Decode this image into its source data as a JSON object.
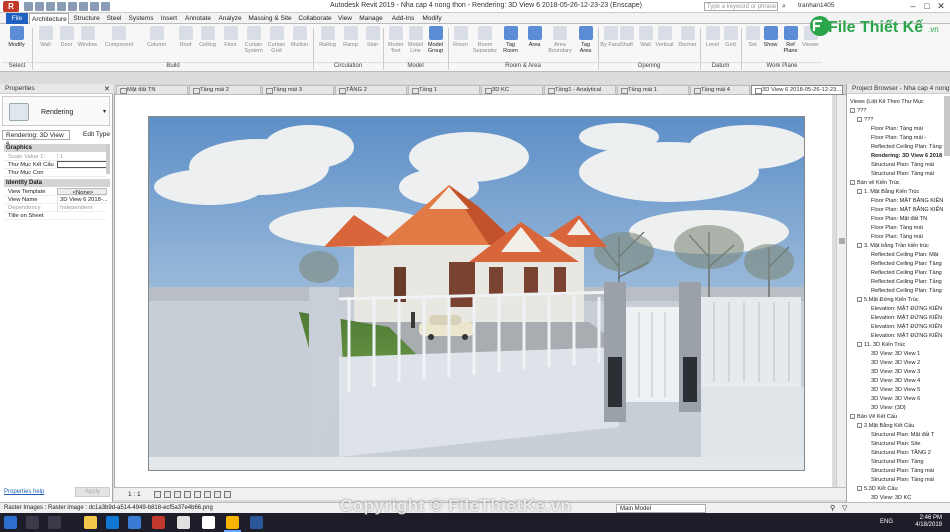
{
  "titlebar": {
    "window_title": "Autodesk Revit 2019 - Nha cap 4 nong thon - Rendering: 3D View 6 2018-05-26-12-23-23 (Enscape)",
    "search_placeholder": "Type a keyword or phrase",
    "user": "tranhan1405"
  },
  "ribbon": {
    "tabs": [
      "File",
      "Architecture",
      "Structure",
      "Steel",
      "Systems",
      "Insert",
      "Annotate",
      "Analyze",
      "Massing & Site",
      "Collaborate",
      "View",
      "Manage",
      "Add-Ins",
      "Modify"
    ],
    "active_tab": "Architecture",
    "tools": [
      "Modify",
      "Wall",
      "Door",
      "Window",
      "Component",
      "Column",
      "Roof",
      "Ceiling",
      "Floor",
      "Curtain System",
      "Curtain Grid",
      "Mullion",
      "Railing",
      "Ramp",
      "Stair",
      "Model Text",
      "Model Line",
      "Model Group",
      "Room",
      "Room Separator",
      "Tag Room",
      "Area",
      "Area Boundary",
      "Tag Area",
      "By Face",
      "Shaft",
      "Wall",
      "Vertical",
      "Dormer",
      "Level",
      "Grid",
      "Set",
      "Show",
      "Ref Plane",
      "Viewer"
    ],
    "groups": [
      "Select",
      "Build",
      "Circulation",
      "Model",
      "Room & Area",
      "Opening",
      "Datum",
      "Work Plane"
    ]
  },
  "properties": {
    "title": "Properties",
    "type_name": "Rendering",
    "selector": "Rendering: 3D View 6",
    "edit_type": "Edit Type",
    "sections": {
      "graphics": "Graphics",
      "identity": "Identity Data"
    },
    "rows": [
      {
        "k": "Scale Value 1:",
        "v": "1"
      },
      {
        "k": "Thư Mục Kết Cấu",
        "v": ""
      },
      {
        "k": "Thư Mục Con",
        "v": ""
      },
      {
        "k": "View Template",
        "v": "<None>"
      },
      {
        "k": "View Name",
        "v": "3D View 6 2018-..."
      },
      {
        "k": "Dependency",
        "v": "Independent"
      },
      {
        "k": "Title on Sheet",
        "v": ""
      }
    ],
    "help": "Properties help",
    "apply": "Apply"
  },
  "view_tabs": [
    "Mặt đất TN",
    "Tầng mái 2",
    "Tầng mái 3",
    "TẦNG 2",
    "Tầng 1",
    "3D KC",
    "Tầng1 - Analytical",
    "Tầng mái 1",
    "Tầng mái 4",
    "3D View 6 2018-05-26-12-23..."
  ],
  "view_tab_active": 9,
  "view_bar": {
    "scale": "1 : 1"
  },
  "project_browser": {
    "title": "Project Browser - Nha cap 4 nong...",
    "items": [
      {
        "t": "Views (Liệt Kê Theo Thư Mục",
        "i": 0,
        "tg": ""
      },
      {
        "t": "???",
        "i": 0,
        "tg": "-"
      },
      {
        "t": "???",
        "i": 1,
        "tg": "-"
      },
      {
        "t": "Floor Plan: Tầng mái",
        "i": 3,
        "tg": ""
      },
      {
        "t": "Floor Plan: Tầng mái -",
        "i": 3,
        "tg": ""
      },
      {
        "t": "Reflected Ceiling Plan: Tầng",
        "i": 3,
        "tg": ""
      },
      {
        "t": "Rendering: 3D View 6 2018",
        "i": 3,
        "tg": "",
        "b": true
      },
      {
        "t": "Structural Plan: Tầng mái",
        "i": 3,
        "tg": ""
      },
      {
        "t": "Structural Plan: Tầng mái",
        "i": 3,
        "tg": ""
      },
      {
        "t": "Bản vẽ Kiến Trúc",
        "i": 0,
        "tg": "-"
      },
      {
        "t": "1. Mặt Bằng Kiến Trúc",
        "i": 1,
        "tg": "-"
      },
      {
        "t": "Floor Plan: MẶT BẰNG KIẾN",
        "i": 3,
        "tg": ""
      },
      {
        "t": "Floor Plan: MẶT BẰNG KIẾN",
        "i": 3,
        "tg": ""
      },
      {
        "t": "Floor Plan: Mặt đất TN",
        "i": 3,
        "tg": ""
      },
      {
        "t": "Floor Plan: Tầng mái",
        "i": 3,
        "tg": ""
      },
      {
        "t": "Floor Plan: Tầng mái",
        "i": 3,
        "tg": ""
      },
      {
        "t": "3. Mặt bằng Trần kiến trúc",
        "i": 1,
        "tg": "-"
      },
      {
        "t": "Reflected Ceiling Plan: Mặt",
        "i": 3,
        "tg": ""
      },
      {
        "t": "Reflected Ceiling Plan: Tầng",
        "i": 3,
        "tg": ""
      },
      {
        "t": "Reflected Ceiling Plan: Tầng",
        "i": 3,
        "tg": ""
      },
      {
        "t": "Reflected Ceiling Plan: Tầng",
        "i": 3,
        "tg": ""
      },
      {
        "t": "Reflected Ceiling Plan: Tầng",
        "i": 3,
        "tg": ""
      },
      {
        "t": "5.Mặt Đứng Kiến Trúc",
        "i": 1,
        "tg": "-"
      },
      {
        "t": "Elevation: MẶT ĐỨNG KIẾN",
        "i": 3,
        "tg": ""
      },
      {
        "t": "Elevation: MẶT ĐỨNG KIẾN",
        "i": 3,
        "tg": ""
      },
      {
        "t": "Elevation: MẶT ĐỨNG KIẾN",
        "i": 3,
        "tg": ""
      },
      {
        "t": "Elevation: MẶT ĐỨNG KIẾN",
        "i": 3,
        "tg": ""
      },
      {
        "t": "11. 3D Kiến Trúc",
        "i": 1,
        "tg": "-"
      },
      {
        "t": "3D View: 3D View 1",
        "i": 3,
        "tg": ""
      },
      {
        "t": "3D View: 3D View 2",
        "i": 3,
        "tg": ""
      },
      {
        "t": "3D View: 3D View 3",
        "i": 3,
        "tg": ""
      },
      {
        "t": "3D View: 3D View 4",
        "i": 3,
        "tg": ""
      },
      {
        "t": "3D View: 3D View 5",
        "i": 3,
        "tg": ""
      },
      {
        "t": "3D View: 3D View 6",
        "i": 3,
        "tg": ""
      },
      {
        "t": "3D View: {3D}",
        "i": 3,
        "tg": ""
      },
      {
        "t": "Bản Vẽ Kết Cấu",
        "i": 0,
        "tg": "-"
      },
      {
        "t": "2.Mặt Bằng Kết Cấu",
        "i": 1,
        "tg": "-"
      },
      {
        "t": "Structural Plan: Mặt đất T",
        "i": 3,
        "tg": ""
      },
      {
        "t": "Structural Plan: Site",
        "i": 3,
        "tg": ""
      },
      {
        "t": "Structural Plan: TẦNG 2",
        "i": 3,
        "tg": ""
      },
      {
        "t": "Structural Plan: Tầng",
        "i": 3,
        "tg": ""
      },
      {
        "t": "Structural Plan: Tầng mái",
        "i": 3,
        "tg": ""
      },
      {
        "t": "Structural Plan: Tầng mái",
        "i": 3,
        "tg": ""
      },
      {
        "t": "5.3D Kết Cấu",
        "i": 1,
        "tg": "-"
      },
      {
        "t": "3D View: 3D KC",
        "i": 3,
        "tg": ""
      }
    ]
  },
  "status": {
    "message": "Raster Images : Raster image : dc1a3b9d-a514-4949-b818-ecf5a37e4b66.png",
    "model": "Main Model"
  },
  "taskbar": {
    "lang": "ENG",
    "time": "2:46 PM",
    "date": "4/18/2019"
  },
  "watermark": "Copyright © FileThietKe.vn",
  "logo": {
    "text": "File Thiết Kế",
    "suffix": ".vn"
  },
  "colors": {
    "accent": "#2060c0",
    "roof": "#d9653b",
    "logo_green": "#2aa54a"
  }
}
